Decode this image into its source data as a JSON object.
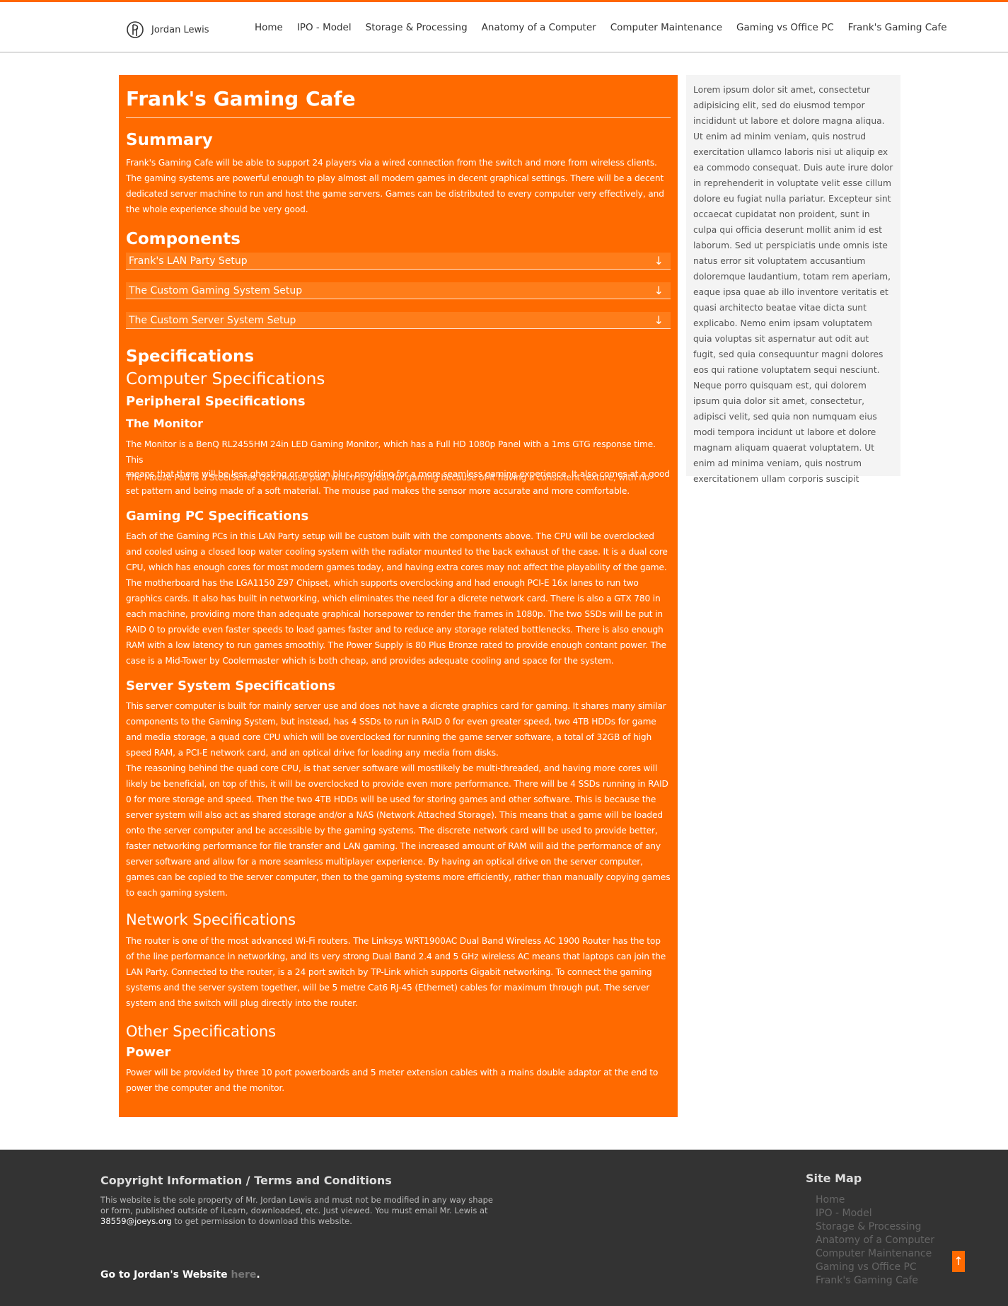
{
  "colors": {
    "accent": "#ff6a00",
    "footer_bg": "#333333",
    "sidebar_bg": "#f4f4f4"
  },
  "brand": {
    "name": "Jordan Lewis",
    "icon": "logo-icon"
  },
  "nav": [
    "Home",
    "IPO - Model",
    "Storage & Processing",
    "Anatomy of a Computer",
    "Computer Maintenance",
    "Gaming vs Office PC",
    "Frank's Gaming Cafe"
  ],
  "main": {
    "title": "Frank's Gaming Cafe",
    "summary_heading": "Summary",
    "summary_text": "Frank's Gaming Cafe will be able to support 24 players via a wired connection from the switch and more from wireless clients. The gaming systems are powerful enough to play almost all modern games in decent graphical settings. There will be a decent dedicated server machine to run and host the game servers. Games can be distributed to every computer very effectively, and the whole experience should be very good.",
    "components_heading": "Components",
    "components": [
      "Frank's LAN Party Setup",
      "The Custom Gaming System Setup",
      "The Custom Server System Setup"
    ],
    "accordion_arrow": "↓",
    "specs_heading": "Specifications",
    "computer_specs_heading": "Computer Specifications",
    "peripheral_heading": "Peripheral Specifications",
    "monitor_heading": "The Monitor",
    "monitor_text_1": "The Monitor is a BenQ RL2455HM 24in LED Gaming Monitor, which has a Full HD 1080p Panel with a 1ms GTG response time. This",
    "monitor_text_2a": "means that there will be less ghosting or motion blur, providing for a more seamless gaming experience. It also comes at a good",
    "monitor_text_2b": "The Mouse Pad is a SteelSeries QcK mouse pad, which is great for gaming because of it having a consistent texture, with no",
    "monitor_text_3": "set pattern and being made of a soft material. The mouse pad makes the sensor more accurate and more comfortable.",
    "gaming_heading": "Gaming PC Specifications",
    "gaming_text": "Each of the Gaming PCs in this LAN Party setup will be custom built with the components above. The CPU will be overclocked and cooled using a closed loop water cooling system with the radiator mounted to the back exhaust of the case. It is a dual core CPU, which has enough cores for most modern games today, and having extra cores may not affect the playability of the game. The motherboard has the LGA1150 Z97 Chipset, which supports overclocking and had enough PCI-E 16x lanes to run two graphics cards. It also has built in networking, which eliminates the need for a dicrete network card. There is also a GTX 780 in each machine, providing more than adequate graphical horsepower to render the frames in 1080p. The two SSDs will be put in RAID 0 to provide even faster speeds to load games faster and to reduce any storage related bottlenecks. There is also enough RAM with a low latency to run games smoothly. The Power Supply is 80 Plus Bronze rated to provide enough contant power. The case is a Mid-Tower by Coolermaster which is both cheap, and provides adequate cooling and space for the system.",
    "server_heading": "Server System Specifications",
    "server_text_1": "This server computer is built for mainly server use and does not have a dicrete graphics card for gaming. It shares many similar components to the Gaming System, but instead, has 4 SSDs to run in RAID 0 for even greater speed, two 4TB HDDs for game and media storage, a quad core CPU which will be overclocked for running the game server software, a total of 32GB of high speed RAM, a PCI-E network card, and an optical drive for loading any media from disks.",
    "server_text_2": "The reasoning behind the quad core CPU, is that server software will mostlikely be multi-threaded, and having more cores will likely be beneficial, on top of this, it will be overclocked to provide even more performance. There will be 4 SSDs running in RAID 0 for more storage and speed. Then the two 4TB HDDs will be used for storing games and other software. This is because the server system will also act as shared storage and/or a NAS (Network Attached Storage). This means that a game will be loaded onto the server computer and be accessible by the gaming systems. The discrete network card will be used to provide better, faster networking performance for file transfer and LAN gaming. The increased amount of RAM will aid the performance of any server software and allow for a more seamless multiplayer experience. By having an optical drive on the server computer, games can be copied to the server computer, then to the gaming systems more efficiently, rather than manually copying games to each gaming system.",
    "network_heading": "Network Specifications",
    "network_text": "The router is one of the most advanced Wi-Fi routers. The Linksys WRT1900AC Dual Band Wireless AC 1900 Router has the top of the line performance in networking, and its very strong Dual Band 2.4 and 5 GHz wireless AC means that laptops can join the LAN Party. Connected to the router, is a 24 port switch by TP-Link which supports Gigabit networking. To connect the gaming systems and the server system together, will be 5 metre Cat6 RJ-45 (Ethernet) cables for maximum through put. The server system and the switch will plug directly into the router.",
    "other_heading": "Other Specifications",
    "power_heading": "Power",
    "power_text": "Power will be provided by three 10 port powerboards and 5 meter extension cables with a mains double adaptor at the end to power the computer and the monitor."
  },
  "sidebar": {
    "text": "Lorem ipsum dolor sit amet, consectetur adipisicing elit, sed do eiusmod tempor incididunt ut labore et dolore magna aliqua. Ut enim ad minim veniam, quis nostrud exercitation ullamco laboris nisi ut aliquip ex ea commodo consequat. Duis aute irure dolor in reprehenderit in voluptate velit esse cillum dolore eu fugiat nulla pariatur. Excepteur sint occaecat cupidatat non proident, sunt in culpa qui officia deserunt mollit anim id est laborum. Sed ut perspiciatis unde omnis iste natus error sit voluptatem accusantium doloremque laudantium, totam rem aperiam, eaque ipsa quae ab illo inventore veritatis et quasi architecto beatae vitae dicta sunt explicabo. Nemo enim ipsam voluptatem quia voluptas sit aspernatur aut odit aut fugit, sed quia consequuntur magni dolores eos qui ratione voluptatem sequi nesciunt. Neque porro quisquam est, qui dolorem ipsum quia dolor sit amet, consectetur, adipisci velit, sed quia non numquam eius modi tempora incidunt ut labore et dolore magnam aliquam quaerat voluptatem. Ut enim ad minima veniam, quis nostrum exercitationem ullam corporis suscipit"
  },
  "footer": {
    "copyright_title": "Copyright Information / Terms and Conditions",
    "copyright_text": "This website is the sole property of Mr. Jordan Lewis and must not be modified in any way shape or form, published outside of iLearn, downloaded, etc. Just viewed. You must email Mr. Lewis at",
    "email": "38559@joeys.org",
    "copyright_text_end": "to get permission to download this website.",
    "goto_text": "Go to Jordan's Website",
    "here_link": "here",
    "goto_end": ".",
    "sitemap_title": "Site Map",
    "sitemap": [
      "Home",
      "IPO - Model",
      "Storage & Processing",
      "Anatomy of a Computer",
      "Computer Maintenance",
      "Gaming vs Office PC",
      "Frank's Gaming Cafe"
    ],
    "scroll_top_label": "↑",
    "scroll_top_icon": "arrow-up-icon"
  }
}
